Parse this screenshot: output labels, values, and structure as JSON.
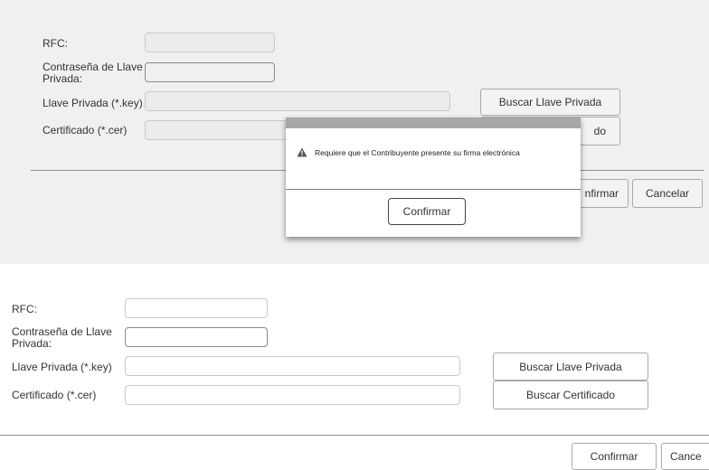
{
  "top_form": {
    "rfc_label": "RFC:",
    "password_label": "Contraseña de Llave Privada:",
    "key_label": "Llave Privada (*.key)",
    "cert_label": "Certificado (*.cer)",
    "browse_key_button": "Buscar Llave Privada",
    "browse_cert_button_partial": "do",
    "confirm_button_partial": "nfirmar",
    "cancel_button": "Cancelar"
  },
  "dialog": {
    "message": "Requiere que el Contribuyente presente su firma electrónica",
    "confirm_button": "Confirmar"
  },
  "bottom_form": {
    "rfc_label": "RFC:",
    "password_label": "Contraseña de Llave Privada:",
    "key_label": "Llave Privada (*.key)",
    "cert_label": "Certificado (*.cer)",
    "browse_key_button": "Buscar Llave Privada",
    "browse_cert_button": "Buscar Certificado",
    "confirm_button": "Confirmar",
    "cancel_button_partial": "Cance"
  }
}
